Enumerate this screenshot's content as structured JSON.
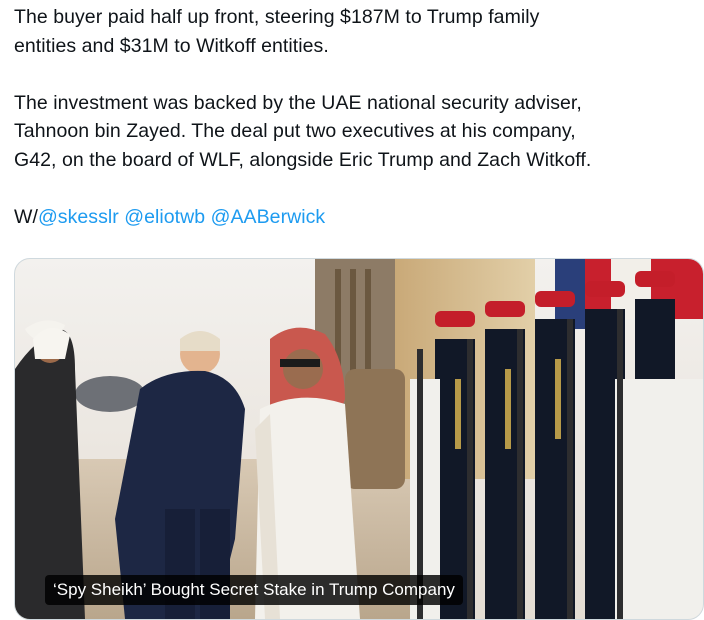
{
  "tweet": {
    "paragraph_1_line_1": "The buyer paid half up front, steering $187M to Trump family",
    "paragraph_1_line_2": "entities and $31M to Witkoff entities.",
    "paragraph_2_line_1": "The investment was backed by the UAE national security adviser,",
    "paragraph_2_line_2": "Tahnoon bin Zayed. The deal put two executives at his company,",
    "paragraph_2_line_3": "G42, on the board of WLF, alongside Eric Trump and Zach Witkoff.",
    "with_prefix": "W/",
    "mentions": [
      "@skesslr",
      "@eliotwb",
      "@AABerwick"
    ]
  },
  "media": {
    "caption": "‘Spy Sheikh’ Bought Secret Stake in Trump Company"
  },
  "colors": {
    "link": "#1d9bf0",
    "text": "#0f1419",
    "border": "#cfd9de"
  }
}
